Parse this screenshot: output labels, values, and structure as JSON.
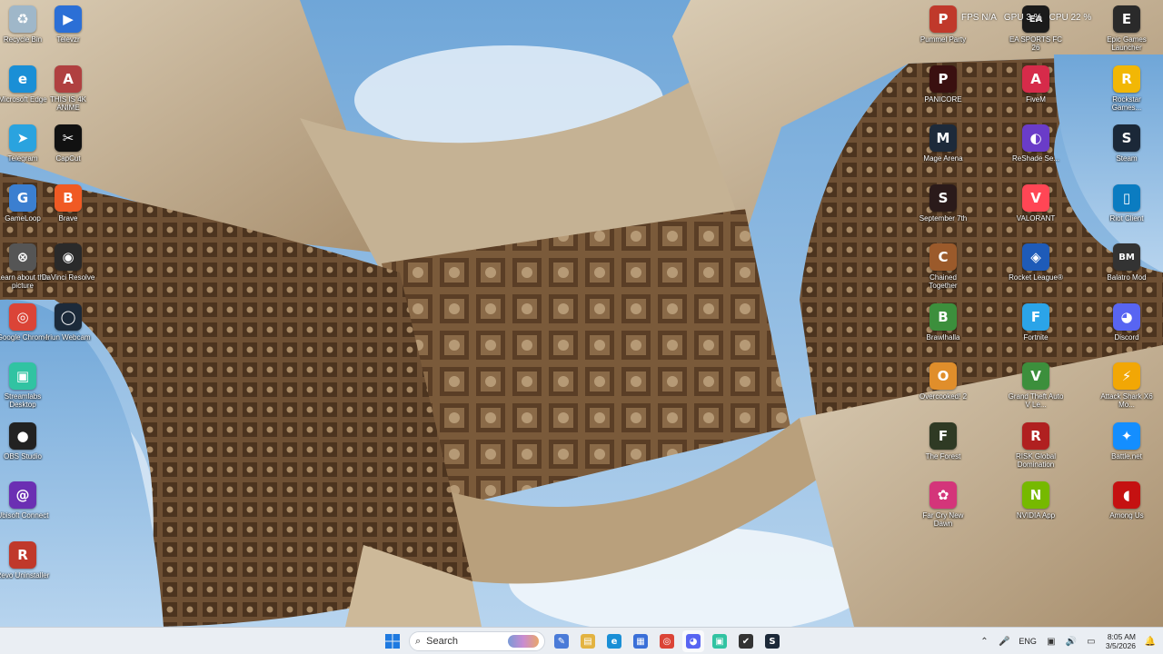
{
  "overlay": {
    "fps_label": "FPS",
    "fps_value": "N/A",
    "gpu_label": "GPU",
    "gpu_value": "3 %",
    "cpu_label": "CPU",
    "cpu_value": "22 %"
  },
  "desktop_icons": {
    "left": [
      {
        "label": "Recycle Bin",
        "icon": "recycle-bin-icon",
        "color": "#9fb7c9",
        "glyph": "♻"
      },
      {
        "label": "Televzr",
        "icon": "televzr-icon",
        "color": "#2b6fd6",
        "glyph": "▶"
      },
      {
        "label": "Microsoft Edge",
        "icon": "edge-icon",
        "color": "#1a8fd6",
        "glyph": "e"
      },
      {
        "label": "THIS IS 4K ANIME",
        "icon": "anime-icon",
        "color": "#b04040",
        "glyph": "A"
      },
      {
        "label": "Telegram",
        "icon": "telegram-icon",
        "color": "#2aa3df",
        "glyph": "➤"
      },
      {
        "label": "CapCut",
        "icon": "capcut-icon",
        "color": "#111111",
        "glyph": "✂"
      },
      {
        "label": "GameLoop",
        "icon": "gameloop-icon",
        "color": "#3b7fd0",
        "glyph": "G"
      },
      {
        "label": "Brave",
        "icon": "brave-icon",
        "color": "#f05a24",
        "glyph": "B"
      },
      {
        "label": "Learn about this picture",
        "icon": "learn-picture-icon",
        "color": "#555555",
        "glyph": "⊗"
      },
      {
        "label": "DaVinci Resolve",
        "icon": "davinci-icon",
        "color": "#2a2a2a",
        "glyph": "◉"
      },
      {
        "label": "Google Chrome",
        "icon": "chrome-icon",
        "color": "#db4437",
        "glyph": "◎"
      },
      {
        "label": "Iriun Webcam",
        "icon": "iriun-webcam-icon",
        "color": "#1c2a3a",
        "glyph": "◯"
      },
      {
        "label": "Streamlabs Desktop",
        "icon": "streamlabs-icon",
        "color": "#31c3a2",
        "glyph": "▣"
      },
      {
        "label": "OBS Studio",
        "icon": "obs-icon",
        "color": "#222222",
        "glyph": "●"
      },
      {
        "label": "Ubisoft Connect",
        "icon": "ubisoft-icon",
        "color": "#6b2fb3",
        "glyph": "@"
      },
      {
        "label": "Revo Uninstaller",
        "icon": "revo-icon",
        "color": "#c0392b",
        "glyph": "R"
      }
    ],
    "right": [
      {
        "label": "Pummel Party",
        "icon": "pummel-party-icon",
        "color": "#c0392b",
        "glyph": "P"
      },
      {
        "label": "EA SPORTS FC 26",
        "icon": "ea-fc-icon",
        "color": "#1b1b1b",
        "glyph": "EA"
      },
      {
        "label": "Epic Games Launcher",
        "icon": "epic-games-icon",
        "color": "#2a2a2a",
        "glyph": "E"
      },
      {
        "label": "PANICORE",
        "icon": "panicore-icon",
        "color": "#3a1010",
        "glyph": "P"
      },
      {
        "label": "FiveM",
        "icon": "fivem-icon",
        "color": "#d62b4a",
        "glyph": "A"
      },
      {
        "label": "Rockstar Games...",
        "icon": "rockstar-icon",
        "color": "#f2b705",
        "glyph": "R"
      },
      {
        "label": "Mage Arena",
        "icon": "mage-arena-icon",
        "color": "#1d2a3a",
        "glyph": "M"
      },
      {
        "label": "ReShade Se...",
        "icon": "reshade-icon",
        "color": "#6a3cc8",
        "glyph": "◐"
      },
      {
        "label": "Steam",
        "icon": "steam-icon",
        "color": "#1b2838",
        "glyph": "S"
      },
      {
        "label": "September 7th",
        "icon": "september-icon",
        "color": "#2a1a1a",
        "glyph": "S"
      },
      {
        "label": "VALORANT",
        "icon": "valorant-icon",
        "color": "#ff4655",
        "glyph": "V"
      },
      {
        "label": "Riot Client",
        "icon": "riot-client-icon",
        "color": "#0b7cc1",
        "glyph": "▯"
      },
      {
        "label": "Chained Together",
        "icon": "chained-together-icon",
        "color": "#9b5a2b",
        "glyph": "C"
      },
      {
        "label": "Rocket League®",
        "icon": "rocket-league-icon",
        "color": "#1e5bb8",
        "glyph": "◈"
      },
      {
        "label": "Balatro Mod",
        "icon": "balatro-icon",
        "color": "#333333",
        "glyph": "BM"
      },
      {
        "label": "Brawlhalla",
        "icon": "brawlhalla-icon",
        "color": "#3c8f3c",
        "glyph": "B"
      },
      {
        "label": "Fortnite",
        "icon": "fortnite-icon",
        "color": "#2ba4e8",
        "glyph": "F"
      },
      {
        "label": "Discord",
        "icon": "discord-icon",
        "color": "#5865f2",
        "glyph": "◕"
      },
      {
        "label": "Overcooked! 2",
        "icon": "overcooked-icon",
        "color": "#e08e2b",
        "glyph": "O"
      },
      {
        "label": "Grand Theft Auto V Le...",
        "icon": "gta-icon",
        "color": "#3c8f3c",
        "glyph": "V"
      },
      {
        "label": "Attack Shark X6 Mo...",
        "icon": "attack-shark-icon",
        "color": "#f2a705",
        "glyph": "⚡"
      },
      {
        "label": "The Forest",
        "icon": "the-forest-icon",
        "color": "#2f3a24",
        "glyph": "F"
      },
      {
        "label": "RISK Global Domination",
        "icon": "risk-icon",
        "color": "#b02020",
        "glyph": "R"
      },
      {
        "label": "Battle.net",
        "icon": "battlenet-icon",
        "color": "#148eff",
        "glyph": "✦"
      },
      {
        "label": "Far Cry New Dawn",
        "icon": "far-cry-icon",
        "color": "#d4357a",
        "glyph": "✿"
      },
      {
        "label": "NVIDIA App",
        "icon": "nvidia-icon",
        "color": "#76b900",
        "glyph": "N"
      },
      {
        "label": "Among Us",
        "icon": "among-us-icon",
        "color": "#c51111",
        "glyph": "◖"
      }
    ]
  },
  "taskbar": {
    "search_label": "Search",
    "language": "ENG",
    "time": "8:05 AM",
    "date": "3/5/2026",
    "apps": [
      {
        "name": "copilot",
        "icon": "copilot-icon",
        "color": "#4a7bd8",
        "glyph": "✎"
      },
      {
        "name": "file explorer",
        "icon": "file-explorer-icon",
        "color": "#e3b341",
        "glyph": "▤"
      },
      {
        "name": "edge",
        "icon": "edge-icon",
        "color": "#1a8fd6",
        "glyph": "e"
      },
      {
        "name": "store",
        "icon": "store-icon",
        "color": "#3a6fd8",
        "glyph": "▦"
      },
      {
        "name": "chrome",
        "icon": "chrome-icon",
        "color": "#db4437",
        "glyph": "◎"
      },
      {
        "name": "discord",
        "icon": "discord-icon",
        "color": "#5865f2",
        "glyph": "◕"
      },
      {
        "name": "streamlabs",
        "icon": "streamlabs-icon",
        "color": "#31c3a2",
        "glyph": "▣"
      },
      {
        "name": "davinci",
        "icon": "davinci-icon",
        "color": "#333333",
        "glyph": "✔"
      },
      {
        "name": "steam",
        "icon": "steam-icon",
        "color": "#1b2838",
        "glyph": "S"
      }
    ]
  }
}
